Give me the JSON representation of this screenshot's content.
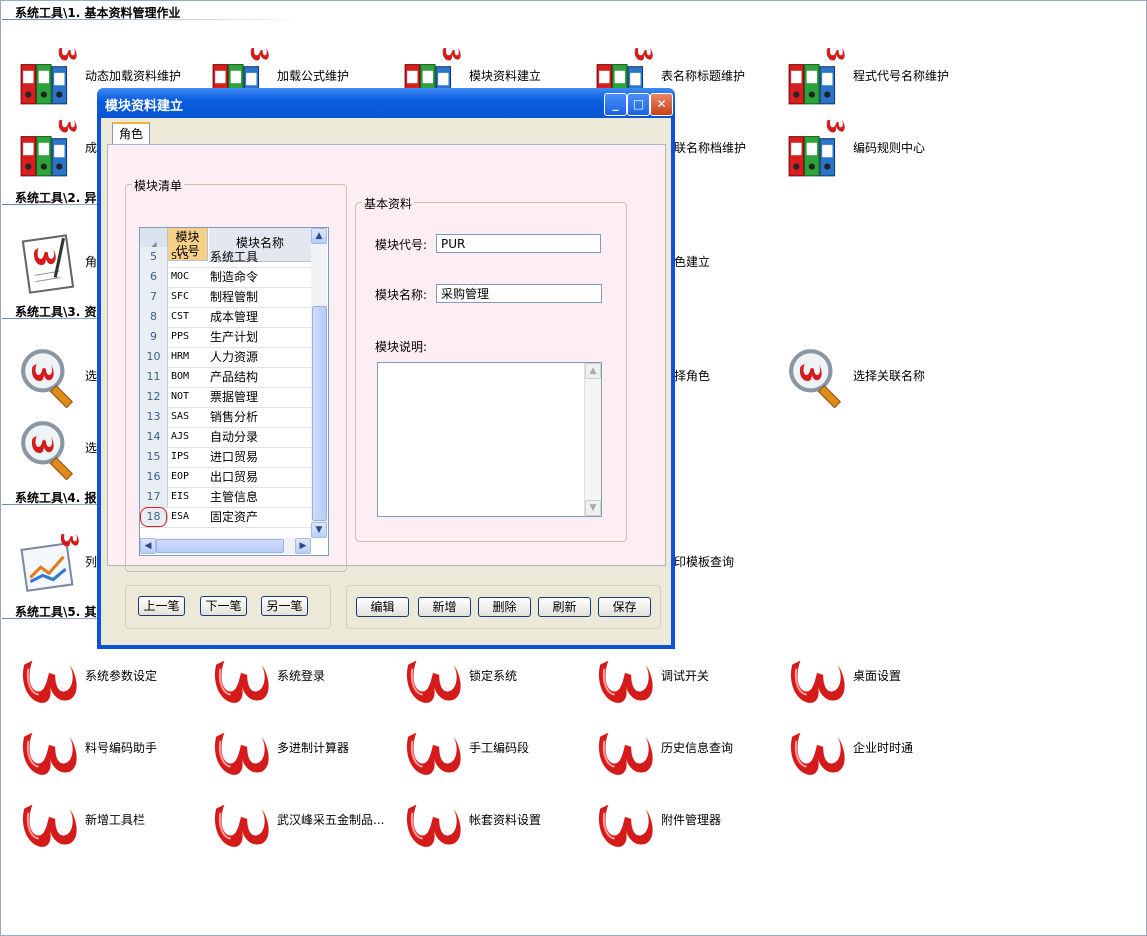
{
  "sections": [
    {
      "title": "系统工具\\1. 基本资料管理作业"
    },
    {
      "title": "系统工具\\2. 异"
    },
    {
      "title": "系统工具\\3. 资"
    },
    {
      "title": "系统工具\\4. 报"
    },
    {
      "title": "系统工具\\5. 其"
    }
  ],
  "items": [
    {
      "label": "动态加载资料维护",
      "icon": "binders-icon"
    },
    {
      "label": "加载公式维护",
      "icon": "binders-icon"
    },
    {
      "label": "模块资料建立",
      "icon": "binders-icon"
    },
    {
      "label": "表名称标题维护",
      "icon": "binders-icon"
    },
    {
      "label": "程式代号名称维护",
      "icon": "binders-icon"
    },
    {
      "label": "成",
      "icon": "binders-icon"
    },
    {
      "label": "联名称档维护",
      "icon": "binders-icon"
    },
    {
      "label": "编码规则中心",
      "icon": "binders-icon"
    },
    {
      "label": "角",
      "icon": "document-pen-icon"
    },
    {
      "label": "色建立",
      "icon": "document-pen-icon"
    },
    {
      "label": "选",
      "icon": "magnifier-icon"
    },
    {
      "label": "择角色",
      "icon": "magnifier-icon"
    },
    {
      "label": "选择关联名称",
      "icon": "magnifier-icon"
    },
    {
      "label": "选",
      "icon": "magnifier-icon"
    },
    {
      "label": "列",
      "icon": "report-chart-icon"
    },
    {
      "label": "印模板查询",
      "icon": "report-chart-icon"
    },
    {
      "label": "系统参数设定",
      "icon": "brand-logo-icon"
    },
    {
      "label": "系统登录",
      "icon": "brand-logo-icon"
    },
    {
      "label": "锁定系统",
      "icon": "brand-logo-icon"
    },
    {
      "label": "调试开关",
      "icon": "brand-logo-icon"
    },
    {
      "label": "桌面设置",
      "icon": "brand-logo-icon"
    },
    {
      "label": "料号编码助手",
      "icon": "brand-logo-icon"
    },
    {
      "label": "多进制计算器",
      "icon": "brand-logo-icon"
    },
    {
      "label": "手工编码段",
      "icon": "brand-logo-icon"
    },
    {
      "label": "历史信息查询",
      "icon": "brand-logo-icon"
    },
    {
      "label": "企业时时通",
      "icon": "brand-logo-icon"
    },
    {
      "label": "新增工具栏",
      "icon": "brand-logo-icon"
    },
    {
      "label": "武汉峰采五金制品...",
      "icon": "brand-logo-icon"
    },
    {
      "label": "帐套资料设置",
      "icon": "brand-logo-icon"
    },
    {
      "label": "附件管理器",
      "icon": "brand-logo-icon"
    }
  ],
  "dialog": {
    "title": "模块资料建立",
    "tab": "角色",
    "list_group": "模块清单",
    "grid": {
      "col_code": [
        "模块",
        "代号"
      ],
      "col_name": "模块名称",
      "rows": [
        {
          "n": "5",
          "code": "SYS",
          "name": "系统工具"
        },
        {
          "n": "6",
          "code": "MOC",
          "name": "制造命令"
        },
        {
          "n": "7",
          "code": "SFC",
          "name": "制程管制"
        },
        {
          "n": "8",
          "code": "CST",
          "name": "成本管理"
        },
        {
          "n": "9",
          "code": "PPS",
          "name": "生产计划"
        },
        {
          "n": "10",
          "code": "HRM",
          "name": "人力资源"
        },
        {
          "n": "11",
          "code": "BOM",
          "name": "产品结构"
        },
        {
          "n": "12",
          "code": "NOT",
          "name": "票据管理"
        },
        {
          "n": "13",
          "code": "SAS",
          "name": "销售分析"
        },
        {
          "n": "14",
          "code": "AJS",
          "name": "自动分录"
        },
        {
          "n": "15",
          "code": "IPS",
          "name": "进口贸易"
        },
        {
          "n": "16",
          "code": "EOP",
          "name": "出口贸易"
        },
        {
          "n": "17",
          "code": "EIS",
          "name": "主管信息"
        },
        {
          "n": "18",
          "code": "ESA",
          "name": "固定资产"
        }
      ]
    },
    "basic_group": "基本资料",
    "code_label": "模块代号:",
    "code_value": "PUR",
    "name_label": "模块名称:",
    "name_value": "采购管理",
    "desc_label": "模块说明:",
    "nav_buttons": [
      "上一笔",
      "下一笔",
      "另一笔"
    ],
    "action_buttons": [
      "编辑",
      "新增",
      "删除",
      "刷新",
      "保存"
    ]
  }
}
